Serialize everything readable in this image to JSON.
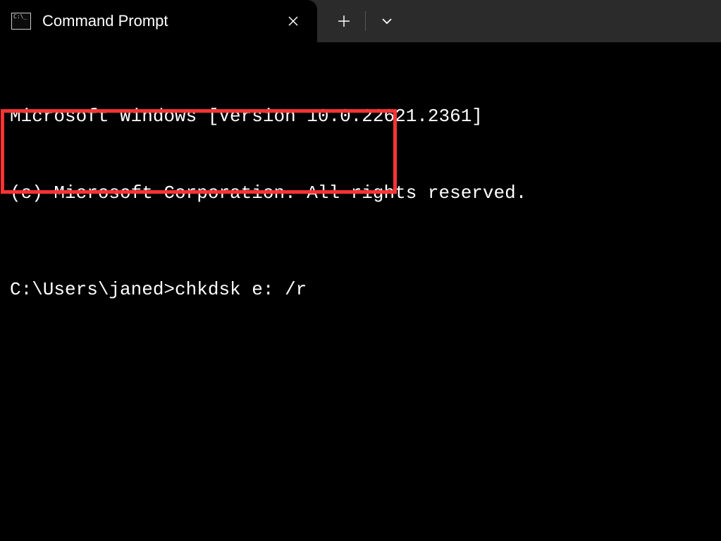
{
  "tab": {
    "title": "Command Prompt"
  },
  "terminal": {
    "line1": "Microsoft Windows [Version 10.0.22621.2361]",
    "line2": "(c) Microsoft Corporation. All rights reserved.",
    "prompt": "C:\\Users\\janed>",
    "command": "chkdsk e: /r"
  }
}
